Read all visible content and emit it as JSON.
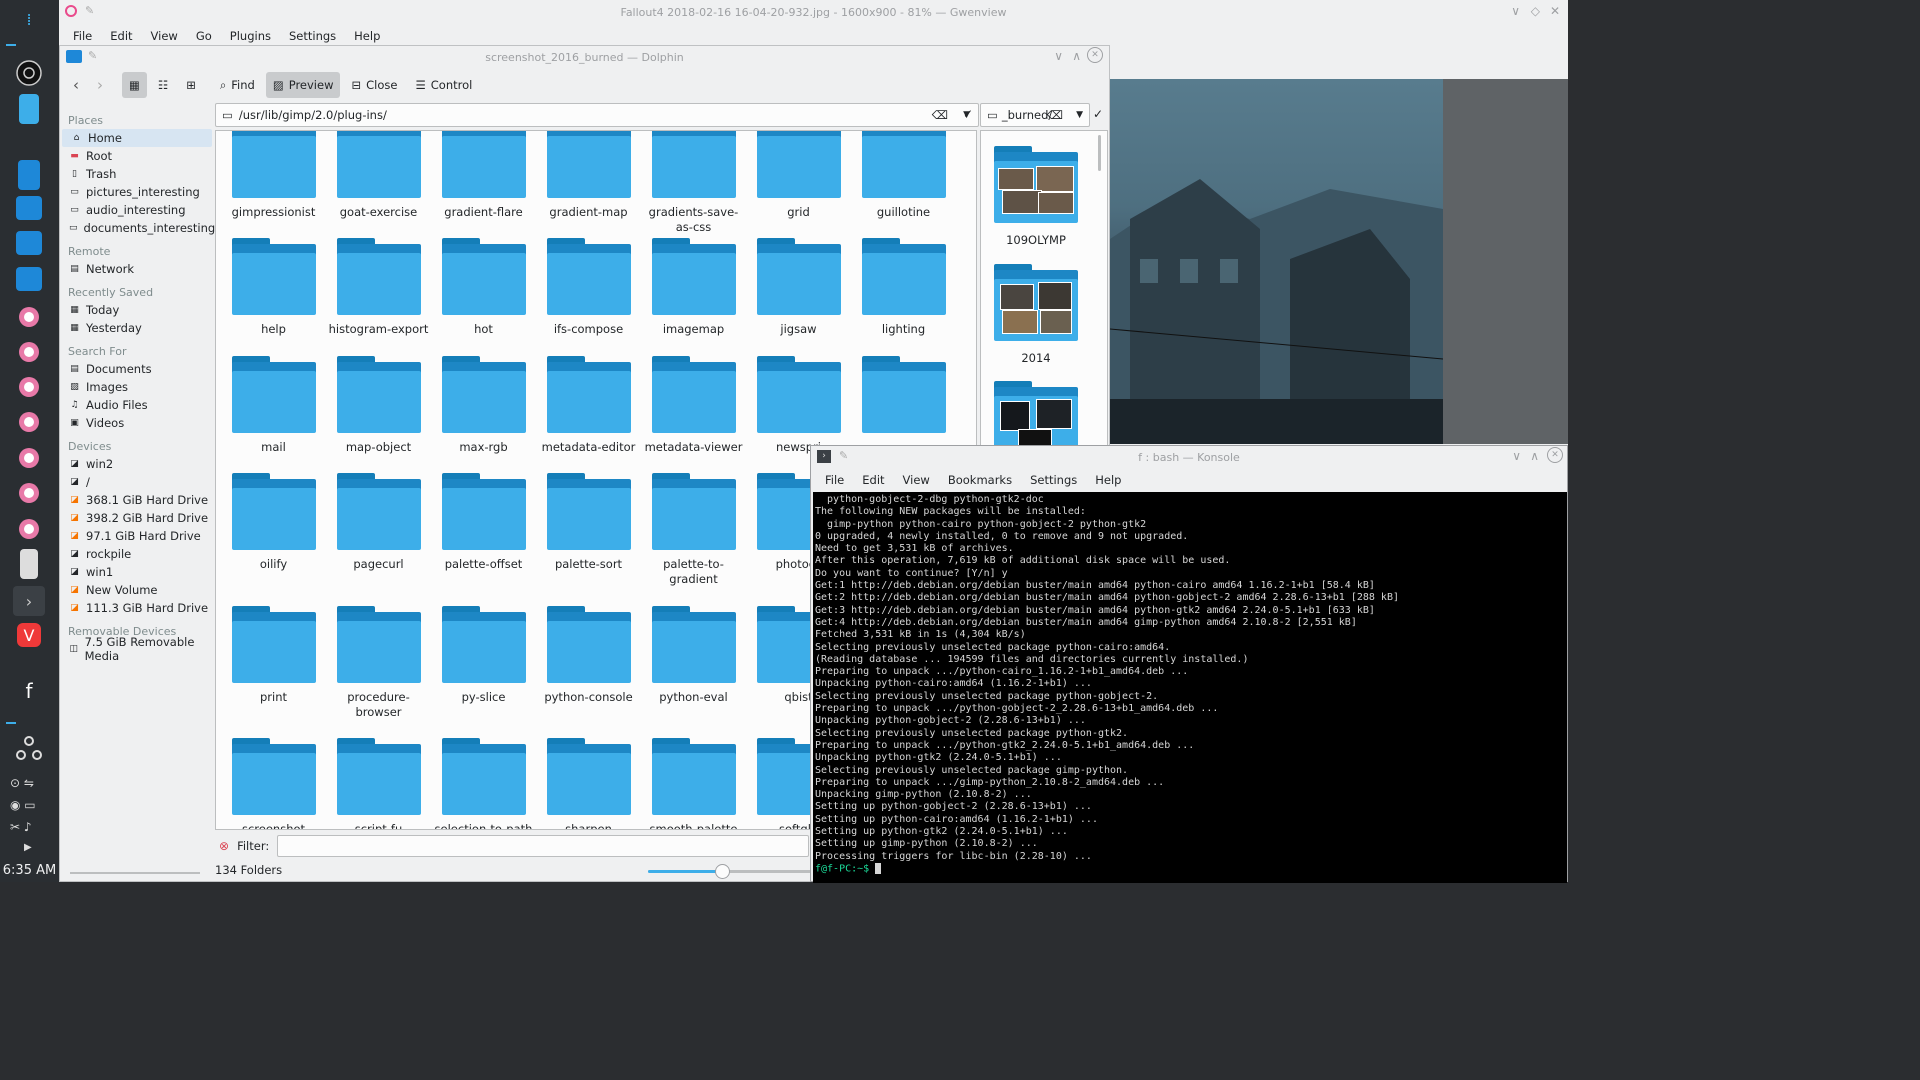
{
  "taskbar": {
    "clock": "6:35 AM",
    "icons": [
      "menu-icon",
      "app-icon",
      "obs-icon",
      "document-icon",
      "store-icon",
      "dolphin-icon",
      "dolphin-icon",
      "dolphin-icon",
      "app-icon",
      "app-icon",
      "app-icon",
      "app-icon",
      "app-icon",
      "app-icon",
      "app-icon",
      "app-icon",
      "terminal-icon",
      "vivaldi-icon",
      "facebook-icon",
      "network-icon"
    ]
  },
  "gwenview": {
    "title": "Fallout4 2018-02-16 16-04-20-932.jpg - 1600x900 - 81% — Gwenview",
    "menu": [
      "File",
      "Edit",
      "View",
      "Go",
      "Plugins",
      "Settings",
      "Help"
    ]
  },
  "dolphin": {
    "title": "screenshot_2016_burned — Dolphin",
    "toolbar": {
      "find": "Find",
      "preview": "Preview",
      "close": "Close",
      "control": "Control"
    },
    "path": "/usr/lib/gimp/2.0/plug-ins/",
    "path2": "_burned/",
    "places": {
      "sections": [
        {
          "header": "Places",
          "items": [
            "Home",
            "Root",
            "Trash",
            "pictures_interesting",
            "audio_interesting",
            "documents_interesting"
          ]
        },
        {
          "header": "Remote",
          "items": [
            "Network"
          ]
        },
        {
          "header": "Recently Saved",
          "items": [
            "Today",
            "Yesterday"
          ]
        },
        {
          "header": "Search For",
          "items": [
            "Documents",
            "Images",
            "Audio Files",
            "Videos"
          ]
        },
        {
          "header": "Devices",
          "items": [
            "win2",
            "/",
            "368.1 GiB Hard Drive",
            "398.2 GiB Hard Drive",
            "97.1 GiB Hard Drive",
            "rockpile",
            "win1",
            "New Volume",
            "111.3 GiB Hard Drive"
          ]
        },
        {
          "header": "Removable Devices",
          "items": [
            "7.5 GiB Removable Media"
          ]
        }
      ]
    },
    "folders": [
      "gimpressionist",
      "goat-exercise",
      "gradient-flare",
      "gradient-map",
      "gradients-save-as-css",
      "grid",
      "guillotine",
      "help",
      "histogram-export",
      "hot",
      "ifs-compose",
      "imagemap",
      "jigsaw",
      "lighting",
      "mail",
      "map-object",
      "max-rgb",
      "metadata-editor",
      "metadata-viewer",
      "newspri",
      "",
      "oilify",
      "pagecurl",
      "palette-offset",
      "palette-sort",
      "palette-to-gradient",
      "photocc",
      "",
      "print",
      "procedure-browser",
      "py-slice",
      "python-console",
      "python-eval",
      "qbist",
      "",
      "screenshot",
      "script-fu",
      "selection-to-path",
      "sharpen",
      "smooth-palette",
      "softglo",
      ""
    ],
    "preview_folders": [
      "109OLYMP",
      "2014",
      ""
    ],
    "filter_label": "Filter:",
    "status": "134 Folders",
    "zoom_fraction": 0.45
  },
  "konsole": {
    "title": "f : bash — Konsole",
    "menu": [
      "File",
      "Edit",
      "View",
      "Bookmarks",
      "Settings",
      "Help"
    ],
    "lines": [
      "  python-gobject-2-dbg python-gtk2-doc",
      "The following NEW packages will be installed:",
      "  gimp-python python-cairo python-gobject-2 python-gtk2",
      "0 upgraded, 4 newly installed, 0 to remove and 9 not upgraded.",
      "Need to get 3,531 kB of archives.",
      "After this operation, 7,619 kB of additional disk space will be used.",
      "Do you want to continue? [Y/n] y",
      "Get:1 http://deb.debian.org/debian buster/main amd64 python-cairo amd64 1.16.2-1+b1 [58.4 kB]",
      "Get:2 http://deb.debian.org/debian buster/main amd64 python-gobject-2 amd64 2.28.6-13+b1 [288 kB]",
      "Get:3 http://deb.debian.org/debian buster/main amd64 python-gtk2 amd64 2.24.0-5.1+b1 [633 kB]",
      "Get:4 http://deb.debian.org/debian buster/main amd64 gimp-python amd64 2.10.8-2 [2,551 kB]",
      "Fetched 3,531 kB in 1s (4,304 kB/s)",
      "Selecting previously unselected package python-cairo:amd64.",
      "(Reading database ... 194599 files and directories currently installed.)",
      "Preparing to unpack .../python-cairo_1.16.2-1+b1_amd64.deb ...",
      "Unpacking python-cairo:amd64 (1.16.2-1+b1) ...",
      "Selecting previously unselected package python-gobject-2.",
      "Preparing to unpack .../python-gobject-2_2.28.6-13+b1_amd64.deb ...",
      "Unpacking python-gobject-2 (2.28.6-13+b1) ...",
      "Selecting previously unselected package python-gtk2.",
      "Preparing to unpack .../python-gtk2_2.24.0-5.1+b1_amd64.deb ...",
      "Unpacking python-gtk2 (2.24.0-5.1+b1) ...",
      "Selecting previously unselected package gimp-python.",
      "Preparing to unpack .../gimp-python_2.10.8-2_amd64.deb ...",
      "Unpacking gimp-python (2.10.8-2) ...",
      "Setting up python-gobject-2 (2.28.6-13+b1) ...",
      "Setting up python-cairo:amd64 (1.16.2-1+b1) ...",
      "Setting up python-gtk2 (2.24.0-5.1+b1) ...",
      "Setting up gimp-python (2.10.8-2) ...",
      "Processing triggers for libc-bin (2.28-10) ..."
    ],
    "prompt": "f@f-PC:~$ "
  }
}
